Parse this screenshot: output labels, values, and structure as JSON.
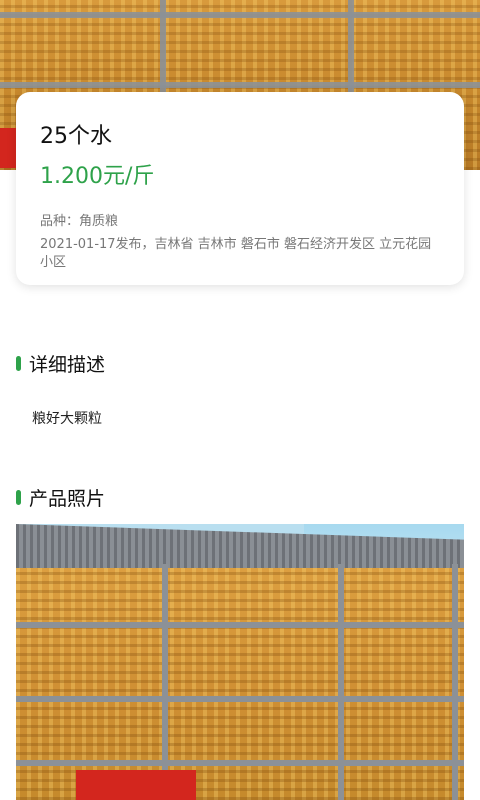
{
  "listing": {
    "title": "25个水",
    "price": "1.200元/斤",
    "variety": "品种：角质粮",
    "meta": "2021-01-17发布，吉林省 吉林市 磐石市 磐石经济开发区 立元花园小区"
  },
  "sections": {
    "description_title": "详细描述",
    "description_text": "粮好大颗粒",
    "photos_title": "产品照片"
  },
  "colors": {
    "accent": "#2ea24a",
    "muted_text": "#777777"
  }
}
